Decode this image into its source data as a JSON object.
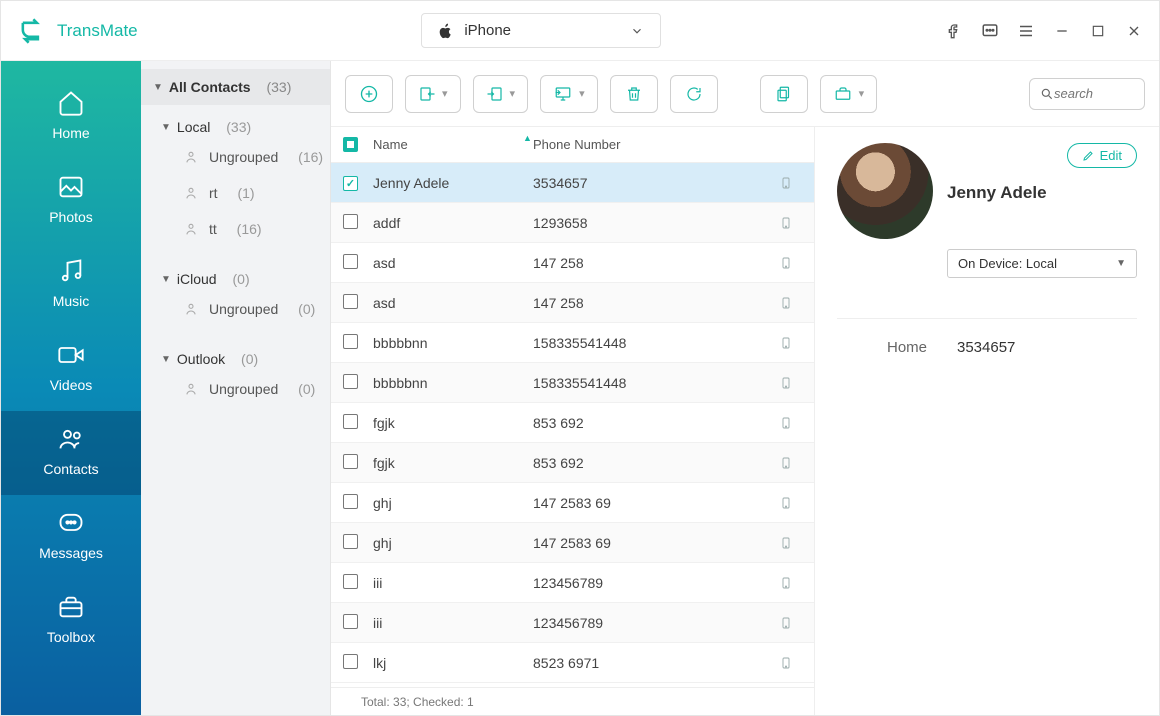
{
  "app": {
    "name": "TransMate"
  },
  "device": {
    "label": "iPhone"
  },
  "search": {
    "placeholder": "search"
  },
  "nav": {
    "home": "Home",
    "photos": "Photos",
    "music": "Music",
    "videos": "Videos",
    "contacts": "Contacts",
    "messages": "Messages",
    "toolbox": "Toolbox"
  },
  "tree": {
    "header": "All Contacts",
    "header_count": "(33)",
    "groups": [
      {
        "title": "Local",
        "count": "(33)",
        "leaves": [
          {
            "label": "Ungrouped",
            "count": "(16)"
          },
          {
            "label": "rt",
            "count": "(1)"
          },
          {
            "label": "tt",
            "count": "(16)"
          }
        ]
      },
      {
        "title": "iCloud",
        "count": "(0)",
        "leaves": [
          {
            "label": "Ungrouped",
            "count": "(0)"
          }
        ]
      },
      {
        "title": "Outlook",
        "count": "(0)",
        "leaves": [
          {
            "label": "Ungrouped",
            "count": "(0)"
          }
        ]
      }
    ]
  },
  "table": {
    "col_name": "Name",
    "col_phone": "Phone Number",
    "rows": [
      {
        "name": "Jenny Adele",
        "phone": "3534657",
        "checked": true
      },
      {
        "name": "addf",
        "phone": "1293658",
        "checked": false
      },
      {
        "name": "asd",
        "phone": "147 258",
        "checked": false
      },
      {
        "name": "asd",
        "phone": "147 258",
        "checked": false
      },
      {
        "name": "bbbbbnn",
        "phone": "158335541448",
        "checked": false
      },
      {
        "name": "bbbbbnn",
        "phone": "158335541448",
        "checked": false
      },
      {
        "name": "fgjk",
        "phone": "853 692",
        "checked": false
      },
      {
        "name": "fgjk",
        "phone": "853 692",
        "checked": false
      },
      {
        "name": "ghj",
        "phone": "147 2583 69",
        "checked": false
      },
      {
        "name": "ghj",
        "phone": "147 2583 69",
        "checked": false
      },
      {
        "name": "iii",
        "phone": "123456789",
        "checked": false
      },
      {
        "name": "iii",
        "phone": "123456789",
        "checked": false
      },
      {
        "name": "lkj",
        "phone": "8523 6971",
        "checked": false
      }
    ],
    "status": "Total: 33; Checked: 1"
  },
  "detail": {
    "name": "Jenny Adele",
    "edit": "Edit",
    "device_select": "On Device: Local",
    "field_label": "Home",
    "field_value": "3534657"
  }
}
